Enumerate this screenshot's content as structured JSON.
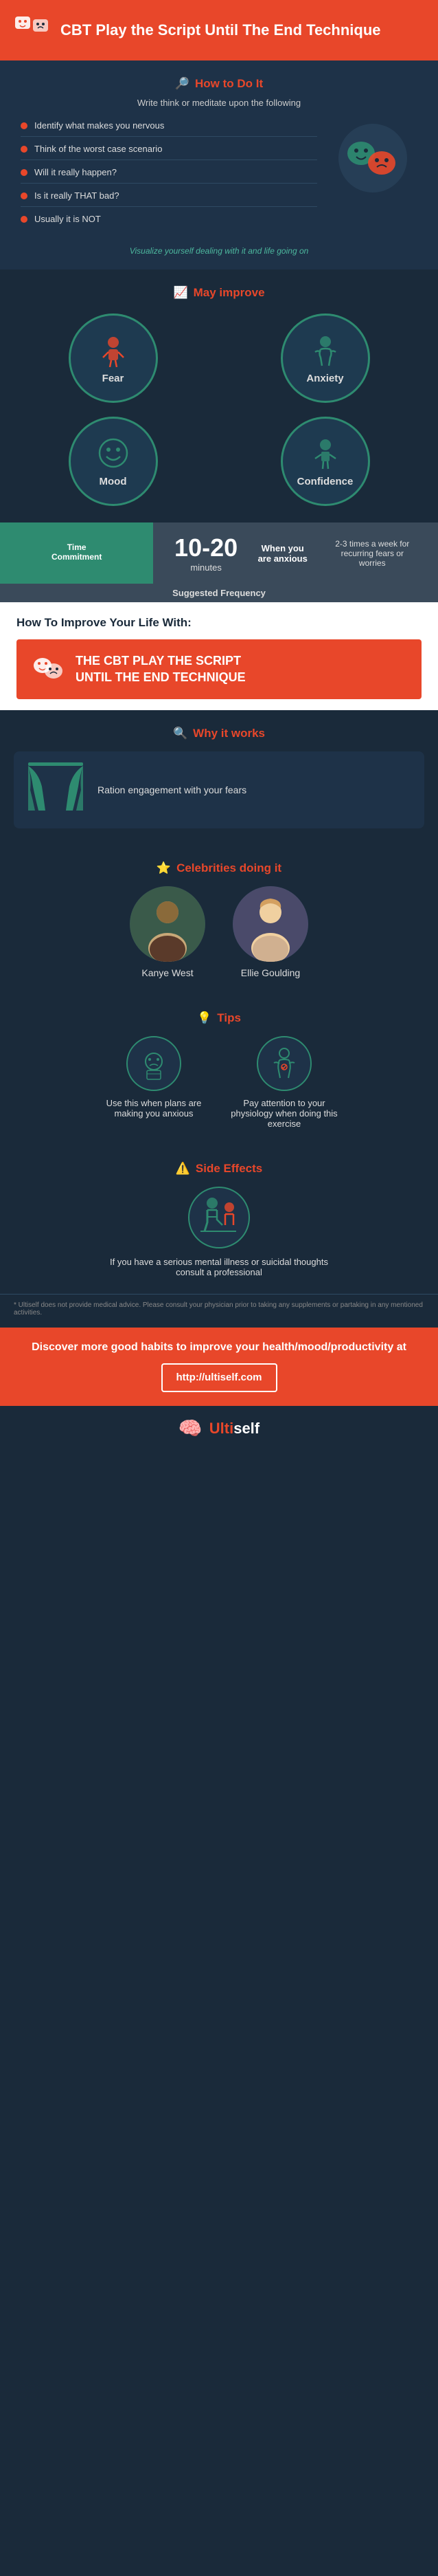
{
  "header": {
    "title": "CBT Play the Script Until The End Technique",
    "icon_label": "theater-mask-icon"
  },
  "how_to": {
    "heading": "How to Do It",
    "heading_icon": "question-icon",
    "subtitle": "Write think or meditate upon the following",
    "steps": [
      "Identify what makes you nervous",
      "Think of the worst case scenario",
      "Will it really happen?",
      "Is it really THAT bad?",
      "Usually it is NOT"
    ],
    "visualize": "Visualize yourself dealing with it and life going on"
  },
  "may_improve": {
    "heading": "May improve",
    "heading_icon": "chart-icon",
    "items": [
      {
        "label": "Fear",
        "icon": "person-nervous-icon"
      },
      {
        "label": "Anxiety",
        "icon": "person-anxiety-icon"
      },
      {
        "label": "Mood",
        "icon": "smiley-icon"
      },
      {
        "label": "Confidence",
        "icon": "person-confidence-icon"
      }
    ]
  },
  "time": {
    "commitment_label": "Time\nCommitment",
    "frequency_label": "Suggested Frequency",
    "duration": "10-20",
    "duration_unit": "minutes",
    "when_label": "When you\nare anxious",
    "frequency_desc": "2-3 times a week for recurring fears or worries"
  },
  "improve_banner": {
    "title": "How To Improve Your Life With:",
    "box_text": "THE CBT PLAY THE SCRIPT\nUNTIL THE END TECHNIQUE",
    "icon": "theater-mask-icon"
  },
  "why": {
    "heading": "Why it works",
    "heading_icon": "search-icon",
    "description": "Ration engagement with your fears",
    "icon": "curtain-icon"
  },
  "celebrities": {
    "heading": "Celebrities doing it",
    "heading_icon": "star-icon",
    "people": [
      {
        "name": "Kanye West"
      },
      {
        "name": "Ellie Goulding"
      }
    ]
  },
  "tips": {
    "heading": "Tips",
    "heading_icon": "lightbulb-icon",
    "items": [
      {
        "text": "Use this when plans are making you anxious",
        "icon": "calendar-icon"
      },
      {
        "text": "Pay attention to your physiology when doing this exercise",
        "icon": "body-icon"
      }
    ]
  },
  "side_effects": {
    "heading": "Side Effects",
    "heading_icon": "warning-icon",
    "description": "If you have a serious mental illness or suicidal thoughts consult a professional",
    "icon": "person-sitting-icon"
  },
  "disclaimer": "* Ultiself does not provide medical advice. Please consult your physician prior to taking any supplements or partaking in any mentioned activities.",
  "footer": {
    "discover_text": "Discover more good habits to improve your health/mood/productivity at",
    "url": "http://ultiself.com",
    "logo_text": "Ultiself",
    "logo_icon": "brain-icon"
  }
}
